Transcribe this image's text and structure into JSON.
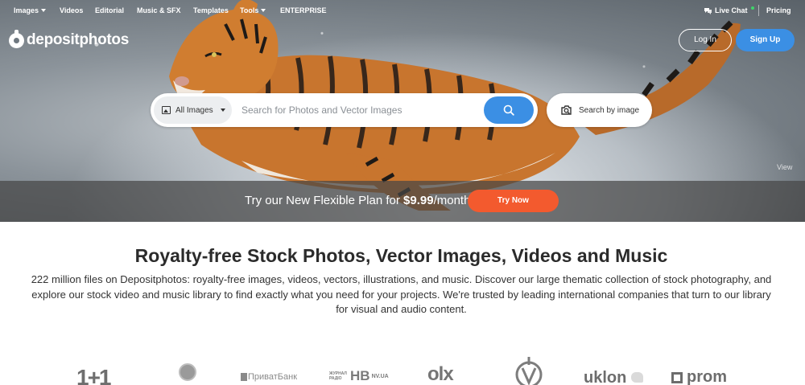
{
  "nav": {
    "items": [
      {
        "label": "Images",
        "dropdown": true
      },
      {
        "label": "Videos",
        "dropdown": false
      },
      {
        "label": "Editorial",
        "dropdown": false
      },
      {
        "label": "Music & SFX",
        "dropdown": false
      },
      {
        "label": "Templates",
        "dropdown": false
      },
      {
        "label": "Tools",
        "dropdown": true
      },
      {
        "label": "ENTERPRISE",
        "dropdown": false
      }
    ],
    "live_chat": "Live Chat",
    "pricing": "Pricing"
  },
  "brand": {
    "name": "depositphotos"
  },
  "auth": {
    "login": "Log In",
    "signup": "Sign Up"
  },
  "search": {
    "type_selected": "All Images",
    "placeholder": "Search for Photos and Vector Images",
    "by_image": "Search by image"
  },
  "hero": {
    "view_label": "View"
  },
  "promo": {
    "text_before": "Try our New Flexible Plan for ",
    "price": "$9.99",
    "text_after": "/month",
    "button": "Try Now"
  },
  "content": {
    "headline": "Royalty-free Stock Photos, Vector Images, Videos and Music",
    "description": "222 million files on Depositphotos: royalty-free images, videos, vectors, illustrations, and music. Discover our large thematic collection of stock photography, and explore our stock video and music library to find exactly what you need for your projects. We're trusted by leading international companies that turn to our library for visual and audio content."
  },
  "clients": {
    "one_plus_one": "1+1",
    "privatbank": "ПриватБанк",
    "radio_top": "ЖУРНАЛ РАДІО",
    "radio_hb": "HB",
    "radio_nv": "NV.UA",
    "olx": "olx",
    "uklon": "uklon",
    "prom": "prom"
  },
  "colors": {
    "accent_blue": "#3b8fe4",
    "promo_orange": "#f35a2e"
  }
}
